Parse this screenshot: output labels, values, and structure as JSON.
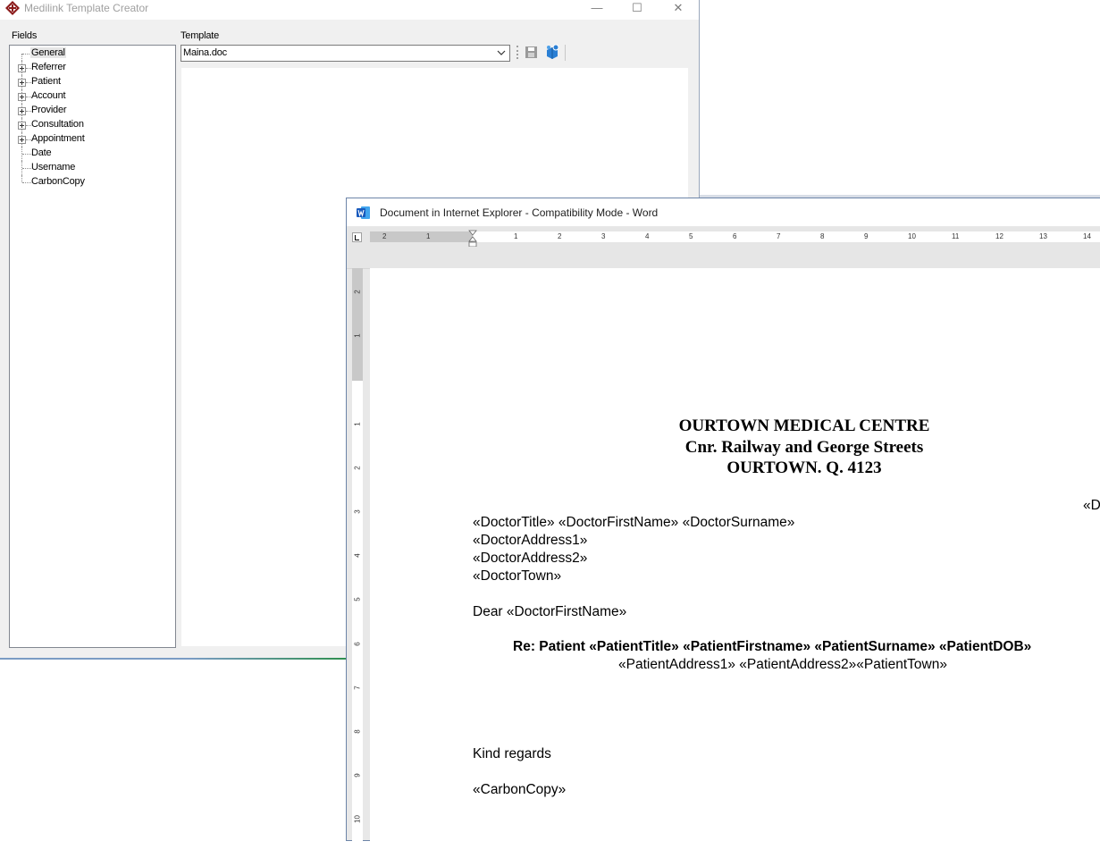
{
  "medilink": {
    "title": "Medilink Template Creator",
    "controls": {
      "minimize": "—",
      "maximize": "☐",
      "close": "✕"
    },
    "fields_label": "Fields",
    "template_label": "Template",
    "template_value": "Maina.doc",
    "tree": [
      {
        "label": "General",
        "expandable": false,
        "selected": true
      },
      {
        "label": "Referrer",
        "expandable": true
      },
      {
        "label": "Patient",
        "expandable": true
      },
      {
        "label": "Account",
        "expandable": true
      },
      {
        "label": "Provider",
        "expandable": true
      },
      {
        "label": "Consultation",
        "expandable": true
      },
      {
        "label": "Appointment",
        "expandable": true
      },
      {
        "label": "Date",
        "expandable": false
      },
      {
        "label": "Username",
        "expandable": false
      },
      {
        "label": "CarbonCopy",
        "expandable": false
      }
    ],
    "toolbar_icons": [
      "save-icon",
      "deploy-icon"
    ]
  },
  "word": {
    "title": "Document in Internet Explorer  -  Compatibility Mode - Word",
    "ruler_h": [
      "2",
      "1",
      "1",
      "2",
      "3",
      "4",
      "5",
      "6",
      "7",
      "8",
      "9",
      "10",
      "11",
      "12",
      "13",
      "14"
    ],
    "ruler_v": [
      "2",
      "1",
      "1",
      "2",
      "3",
      "4",
      "5",
      "6",
      "7",
      "8",
      "9",
      "10"
    ],
    "doc": {
      "heading1": "OURTOWN MEDICAL CENTRE",
      "heading2": "Cnr. Railway and George Streets",
      "heading3": "OURTOWN. Q. 4123",
      "right_field": "«D",
      "addr_line1": "«DoctorTitle» «DoctorFirstName» «DoctorSurname»",
      "addr_line2": "«DoctorAddress1»",
      "addr_line3": "«DoctorAddress2»",
      "addr_line4": "«DoctorTown»",
      "salutation": "Dear «DoctorFirstName»",
      "re_line": "Re: Patient «PatientTitle» «PatientFirstname» «PatientSurname» «PatientDOB»",
      "re_address": "«PatientAddress1» «PatientAddress2»«PatientTown»",
      "closing": "Kind regards",
      "cc": "«CarbonCopy»"
    }
  }
}
